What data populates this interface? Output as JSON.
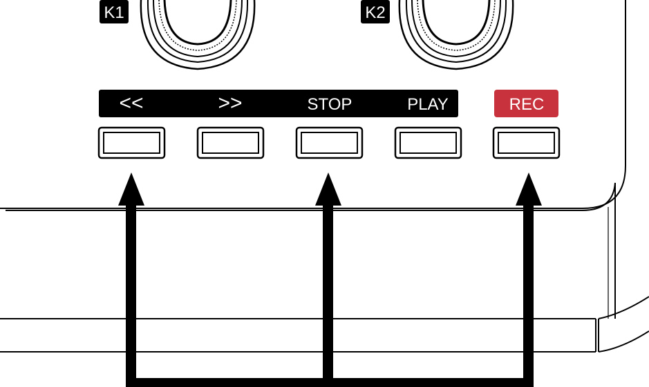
{
  "knobs": [
    {
      "id": "K1",
      "label": "K1"
    },
    {
      "id": "K2",
      "label": "K2"
    }
  ],
  "transport": {
    "rewind_label": "<<",
    "forward_label": ">>",
    "stop_label": "STOP",
    "play_label": "PLAY",
    "rec_label": "REC"
  },
  "colors": {
    "rec_accent": "#C8323C",
    "label_bar": "#000000",
    "outline": "#000000",
    "background": "#FFFFFF"
  },
  "callouts": {
    "arrow_count": 3,
    "points_to": [
      "rewind-button",
      "stop-button",
      "rec-button"
    ]
  }
}
